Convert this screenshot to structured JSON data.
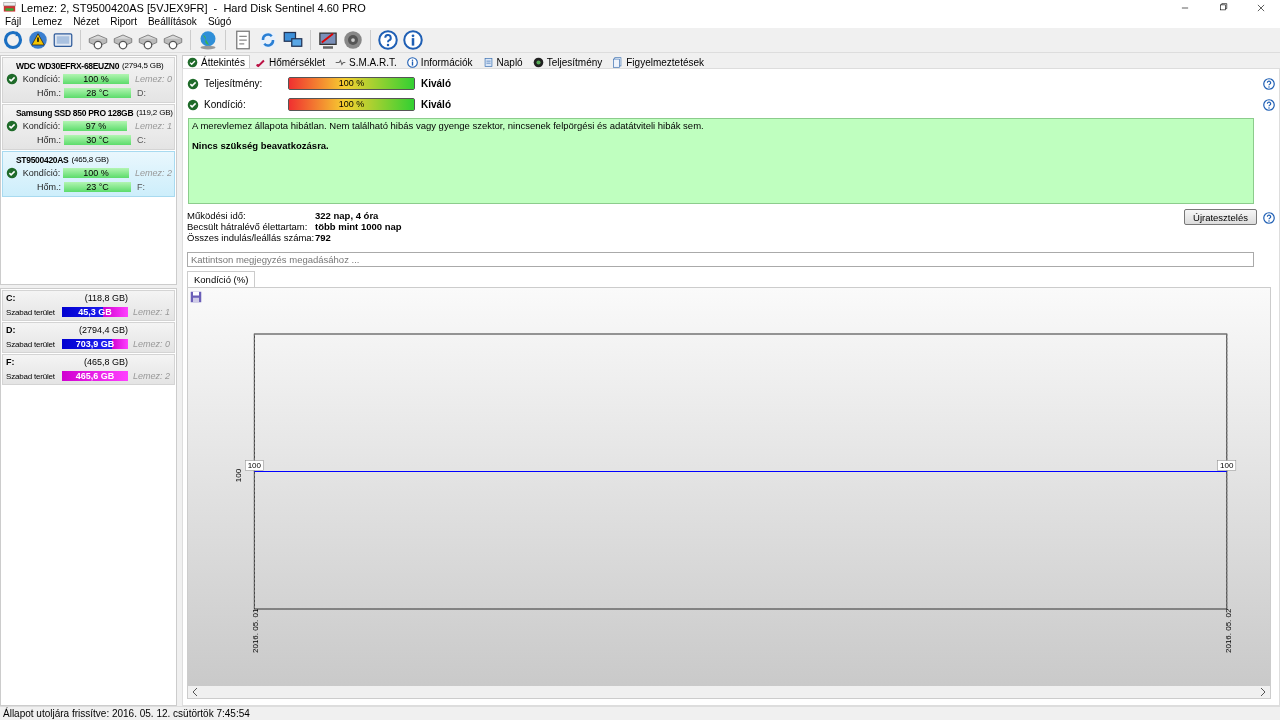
{
  "window": {
    "title": "Lemez: 2, ST9500420AS [5VJEX9FR]  -  Hard Disk Sentinel 4.60 PRO"
  },
  "menu": [
    {
      "label": "Fájl"
    },
    {
      "label": "Lemez"
    },
    {
      "label": "Nézet"
    },
    {
      "label": "Riport"
    },
    {
      "label": "Beállítások"
    },
    {
      "label": "Súgó"
    }
  ],
  "disks": [
    {
      "name": "WDC WD30EFRX-68EUZN0",
      "size": "(2794,5 GB)",
      "selected": false,
      "condition": {
        "label": "Kondíció:",
        "reading": "100 %",
        "level": 1
      },
      "temperature": {
        "label": "Hőm.:",
        "reading": "28 °C",
        "level": 1
      },
      "disk": "Lemez: 0",
      "drive": "D:"
    },
    {
      "name": "Samsung SSD 850 PRO 128GB",
      "size": "(119,2 GB)",
      "selected": false,
      "condition": {
        "label": "Kondíció:",
        "reading": "97 %",
        "level": 0.97
      },
      "temperature": {
        "label": "Hőm.:",
        "reading": "30 °C",
        "level": 1
      },
      "disk": "Lemez: 1",
      "drive": "C:"
    },
    {
      "name": "ST9500420AS",
      "size": "(465,8 GB)",
      "selected": true,
      "condition": {
        "label": "Kondíció:",
        "reading": "100 %",
        "level": 1
      },
      "temperature": {
        "label": "Hőm.:",
        "reading": "23 °C",
        "level": 1
      },
      "disk": "Lemez: 2",
      "drive": "F:"
    }
  ],
  "volumes": [
    {
      "letter": "C:",
      "size": "(118,8 GB)",
      "free_label": "Szabad terület",
      "free": "45,3 GB",
      "level": 0.38,
      "disk": "Lemez: 1"
    },
    {
      "letter": "D:",
      "size": "(2794,4 GB)",
      "free_label": "Szabad terület",
      "free": "703,9 GB",
      "level": 0.25,
      "disk": "Lemez: 0"
    },
    {
      "letter": "F:",
      "size": "(465,8 GB)",
      "free_label": "Szabad terület",
      "free": "465,6 GB",
      "level": 1,
      "disk": "Lemez: 2"
    }
  ],
  "tabs": [
    {
      "label": "Áttekintés",
      "selected": true,
      "kind": "check"
    },
    {
      "label": "Hőmérséklet",
      "selected": false,
      "kind": "thermo"
    },
    {
      "label": "S.M.A.R.T.",
      "selected": false,
      "kind": "smart"
    },
    {
      "label": "Információk",
      "selected": false,
      "kind": "info"
    },
    {
      "label": "Napló",
      "selected": false,
      "kind": "log"
    },
    {
      "label": "Teljesítmény",
      "selected": false,
      "kind": "perf"
    },
    {
      "label": "Figyelmeztetések",
      "selected": false,
      "kind": "alert"
    }
  ],
  "health": [
    {
      "label": "Teljesítmény:",
      "reading": "100 %",
      "level": 1,
      "verdict": "Kiváló"
    },
    {
      "label": "Kondíció:",
      "reading": "100 %",
      "level": 1,
      "verdict": "Kiváló"
    }
  ],
  "message": {
    "text": "A merevlemez állapota hibátlan. Nem található hibás vagy gyenge szektor, nincsenek felpörgési és adatátviteli hibák sem.",
    "advice": "Nincs szükség beavatkozásra."
  },
  "stats": [
    {
      "label": "Működési idő:",
      "value": "322 nap, 4 óra"
    },
    {
      "label": "Becsült hátralévő élettartam:",
      "value": "több mint 1000 nap"
    },
    {
      "label": "Összes indulás/leállás száma:",
      "value": "792"
    }
  ],
  "retest_button": "Újratesztelés",
  "note": {
    "placeholder": "Kattintson megjegyzés megadásához ..."
  },
  "chart_tab": {
    "label": "Kondíció  (%)",
    "selected": true
  },
  "chart": {
    "axis_label": "100",
    "date_labels": [
      "2016. 05. 01",
      "2016. 05. 02"
    ],
    "point_labels": [
      "100",
      "100"
    ]
  },
  "status_bar": "Állapot utoljára frissítve: 2016. 05. 12. csütörtök 7:45:54"
}
